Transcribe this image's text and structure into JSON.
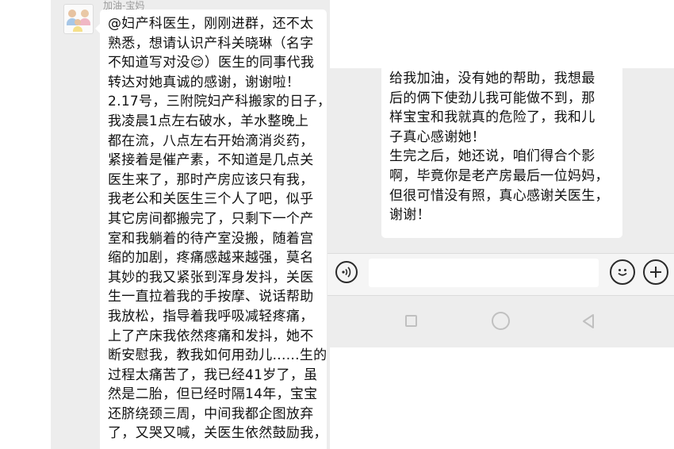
{
  "left_chat": {
    "sender_name": "加油-宝妈",
    "message_lines": [
      "@妇产科医生，刚刚进群，还不太",
      "熟悉，想请认识产科关晓琳（名字",
      "不知道写对没😌）医生的同事代我",
      "转达对她真诚的感谢，谢谢啦！",
      "2.17号，三附院妇产科搬家的日子，",
      "我凌晨1点左右破水，羊水整晚上",
      "都在流，八点左右开始滴消炎药，",
      "紧接着是催产素，不知道是几点关",
      "医生来了，那时产房应该只有我，",
      "我老公和关医生三个人了吧，似乎",
      "其它房间都搬完了，只剩下一个产",
      "室和我躺着的待产室没搬，随着宫",
      "缩的加剧，疼痛感越来越强，莫名",
      "其妙的我又紧张到浑身发抖，关医",
      "生一直拉着我的手按摩、说话帮助",
      "我放松，指导着我呼吸减轻疼痛，",
      "上了产床我依然疼痛和发抖，她不",
      "断安慰我，教我如何用劲儿......生的",
      "过程太痛苦了，我已经41岁了，虽",
      "然是二胎，但已经时隔14年，宝宝",
      "还脐绕颈三周，中间我都企图放弃",
      "了，又哭又喊，关医生依然鼓励我，"
    ]
  },
  "right_chat": {
    "message_lines": [
      "给我加油，没有她的帮助，我想最",
      "后的俩下使劲儿我可能做不到，那",
      "样宝宝和我就真的危险了，我和儿",
      "子真心感谢她！",
      "生完之后，她还说，咱们得合个影",
      "啊，毕竟你是老产房最后一位妈妈，",
      "但很可惜没有照，真心感谢关医生，",
      "谢谢！"
    ],
    "input": {
      "value": "",
      "placeholder": ""
    }
  },
  "colors": {
    "chat_background": "#ededed",
    "bubble": "#ffffff",
    "input_bar": "#f5f5f5",
    "nav_icons": "#c0c0c0"
  }
}
